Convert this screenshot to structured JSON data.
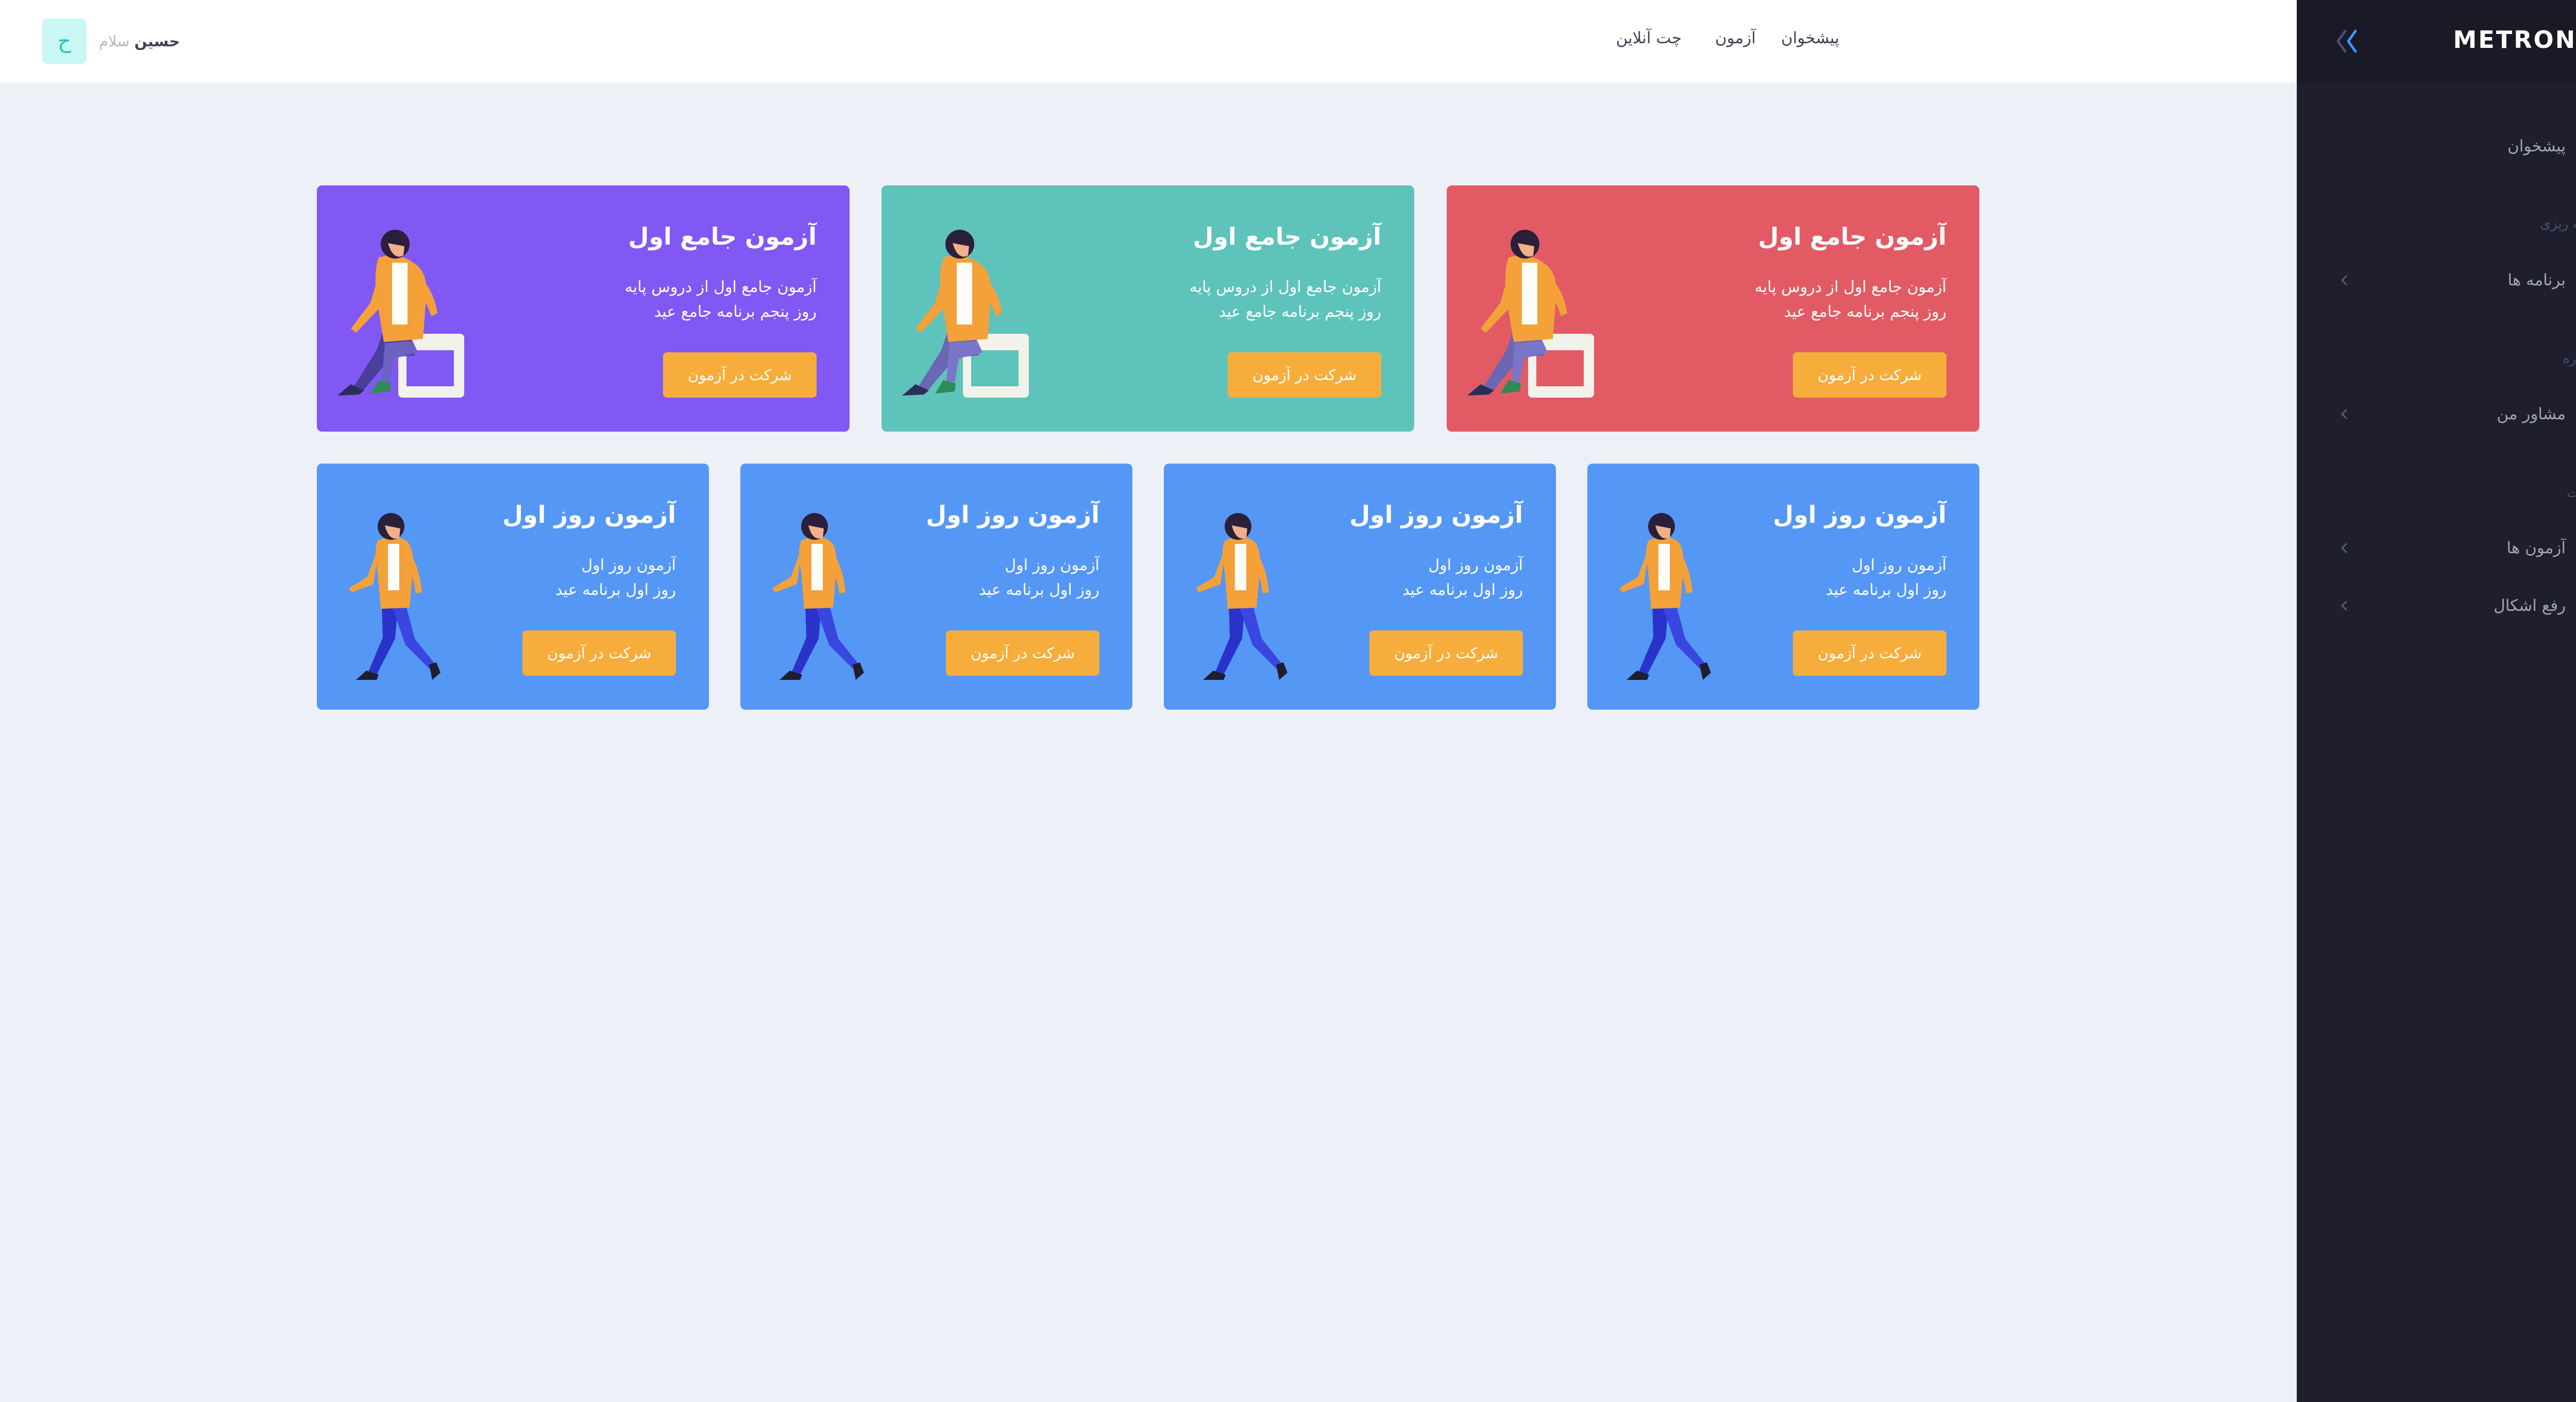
{
  "sidebar": {
    "brand": "METRONIC",
    "items": [
      {
        "label": "پیشخوان",
        "icon": "diamond-icon"
      },
      {
        "section": "برنامه ریزی"
      },
      {
        "label": "برنامه ها",
        "icon": "grid-icon"
      },
      {
        "section": "مشاوره"
      },
      {
        "label": "مشاور من",
        "icon": "paint-bucket-icon"
      },
      {
        "section": "خدمات"
      },
      {
        "label": "آزمون ها",
        "icon": "tool-icon"
      },
      {
        "label": "رفع اشکال",
        "icon": "list-icon"
      }
    ]
  },
  "header": {
    "nav": [
      "پیشخوان",
      "آزمون",
      "چت آنلاین"
    ],
    "greeting": "سلام",
    "user_name": "حسین",
    "avatar_letter": "ح"
  },
  "cards_row1": [
    {
      "title": "آزمون جامع اول",
      "line1": "آزمون جامع اول از دروس پایه",
      "line2": "روز پنجم برنامه جامع عید",
      "button": "شرکت در آزمون",
      "color": "#e25b64"
    },
    {
      "title": "آزمون جامع اول",
      "line1": "آزمون جامع اول از دروس پایه",
      "line2": "روز پنجم برنامه جامع عید",
      "button": "شرکت در آزمون",
      "color": "#5ec3ba"
    },
    {
      "title": "آزمون جامع اول",
      "line1": "آزمون جامع اول از دروس پایه",
      "line2": "روز پنجم برنامه جامع عید",
      "button": "شرکت در آزمون",
      "color": "#8158f4"
    }
  ],
  "cards_row2": [
    {
      "title": "آزمون روز اول",
      "line1": "آزمون روز اول",
      "line2": "روز اول برنامه عید",
      "button": "شرکت در آزمون",
      "color": "#5597f5"
    },
    {
      "title": "آزمون روز اول",
      "line1": "آزمون روز اول",
      "line2": "روز اول برنامه عید",
      "button": "شرکت در آزمون",
      "color": "#5597f5"
    },
    {
      "title": "آزمون روز اول",
      "line1": "آزمون روز اول",
      "line2": "روز اول برنامه عید",
      "button": "شرکت در آزمون",
      "color": "#5597f5"
    },
    {
      "title": "آزمون روز اول",
      "line1": "آزمون روز اول",
      "line2": "روز اول برنامه عید",
      "button": "شرکت در آزمون",
      "color": "#5597f5"
    }
  ],
  "colors": {
    "sidebar_bg": "#1e1e2d",
    "page_bg": "#eef0f8",
    "button": "#f7ad3c",
    "accent": "#3699ff"
  }
}
